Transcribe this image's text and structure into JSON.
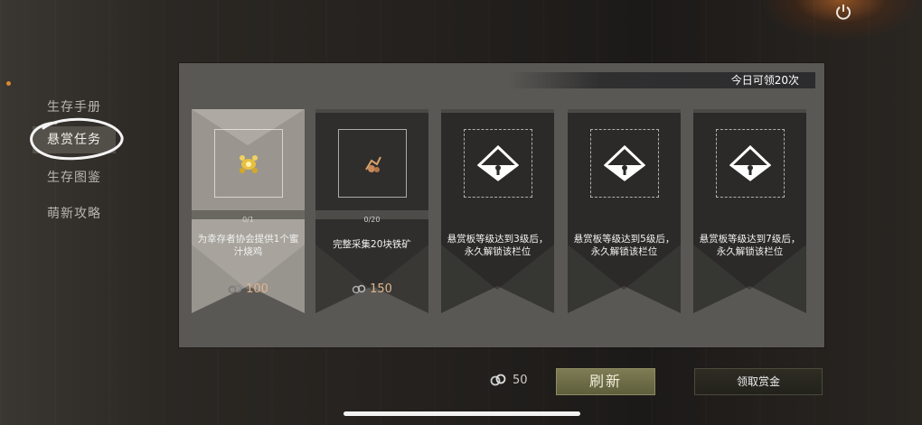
{
  "sidebar": {
    "items": [
      {
        "label": "生存手册"
      },
      {
        "label": "悬赏任务"
      },
      {
        "label": "生存图鉴"
      },
      {
        "label": "萌新攻略"
      }
    ],
    "active_index": 1
  },
  "panel": {
    "daily_limit": "今日可领20次"
  },
  "cards": [
    {
      "progress": "0/1",
      "desc": "为幸存者协会提供1个蜜汁烧鸡",
      "reward": "100",
      "icon": "honey-chicken-icon",
      "locked": false
    },
    {
      "progress": "0/20",
      "desc": "完整采集20块铁矿",
      "reward": "150",
      "icon": "iron-ore-icon",
      "locked": false
    },
    {
      "progress": "",
      "desc": "悬赏板等级达到3级后，永久解锁该栏位",
      "reward": "",
      "icon": "lock-icon",
      "locked": true
    },
    {
      "progress": "",
      "desc": "悬赏板等级达到5级后，永久解锁该栏位",
      "reward": "",
      "icon": "lock-icon",
      "locked": true
    },
    {
      "progress": "",
      "desc": "悬赏板等级达到7级后，永久解锁该栏位",
      "reward": "",
      "icon": "lock-icon",
      "locked": true
    }
  ],
  "footer": {
    "currency": "50",
    "refresh_label": "刷新",
    "claim_label": "领取赏金"
  },
  "colors": {
    "accent_gold": "#e0b48c",
    "refresh_button": "#7d7c54",
    "active_dot": "#d8892f"
  }
}
